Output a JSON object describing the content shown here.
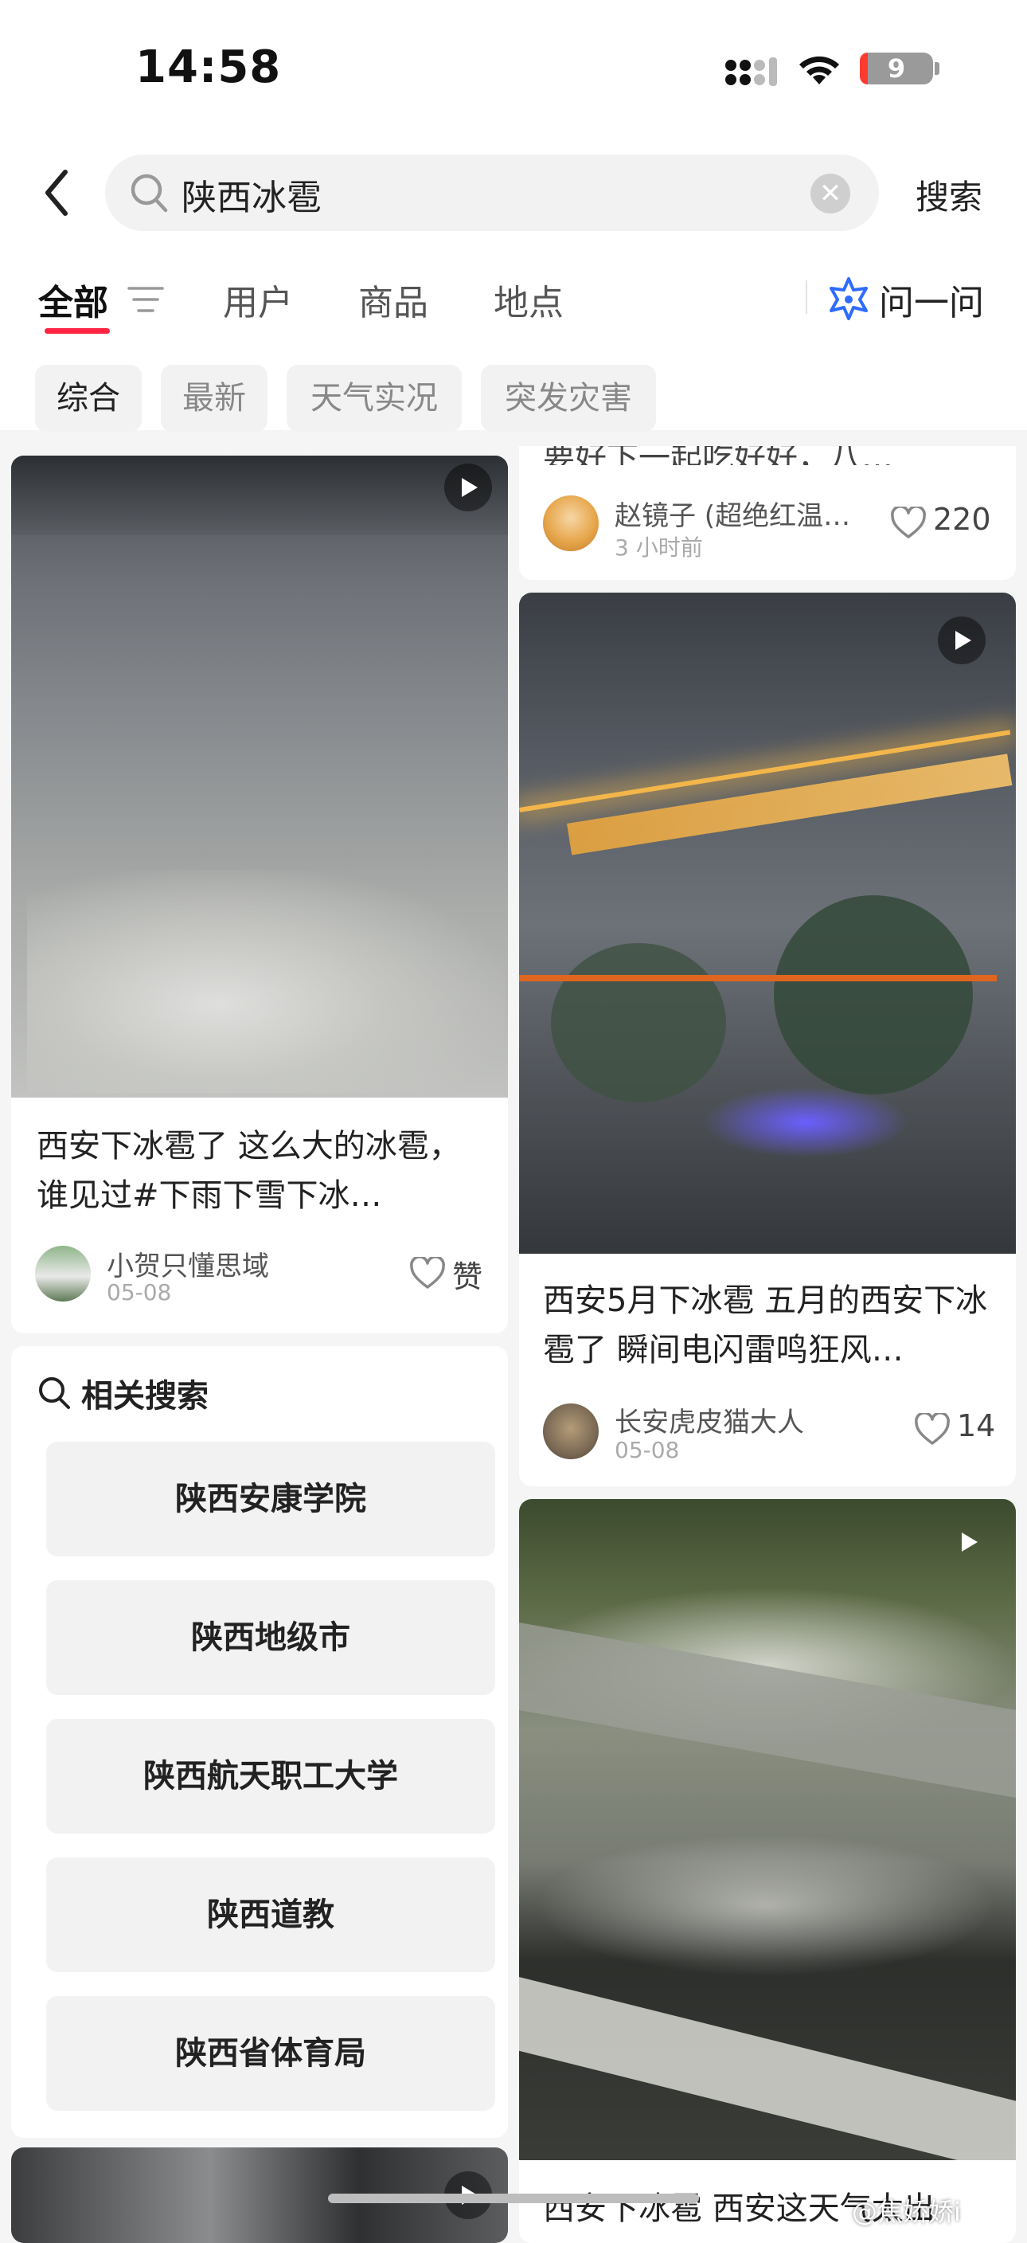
{
  "status_bar": {
    "time": "14:58",
    "battery": "9"
  },
  "search": {
    "query": "陕西冰雹",
    "submit_label": "搜索"
  },
  "tabs": [
    "全部",
    "用户",
    "商品",
    "地点"
  ],
  "ask_label": "问一问",
  "filters": [
    "综合",
    "最新",
    "天气实况",
    "突发灾害"
  ],
  "feed": {
    "left_card_1": {
      "title": "西安下冰雹了 这么大的冰雹，谁见过#下雨下雪下冰…",
      "author": "小贺只懂思域",
      "date": "05-08",
      "likes": "赞"
    },
    "right_card_0": {
      "title_fragment": "要好下一起吃好好，八…",
      "author": "赵镜子 (超绝红温…",
      "date": "3 小时前",
      "likes": "220"
    },
    "right_card_1": {
      "title": "西安5月下冰雹 五月的西安下冰雹了 瞬间电闪雷鸣狂风…",
      "author": "长安虎皮猫大人",
      "date": "05-08",
      "likes": "14"
    },
    "right_card_3": {
      "title_fragment": "西安下冰雹 西安这天气太出"
    }
  },
  "related_search": {
    "heading": "相关搜索",
    "items": [
      "陕西安康学院",
      "陕西地级市",
      "陕西航天职工大学",
      "陕西道教",
      "陕西省体育局"
    ]
  },
  "watermark": "@焦娇娇i",
  "colors": {
    "accent": "#ff2442",
    "ask_icon": "#2f6bff"
  }
}
